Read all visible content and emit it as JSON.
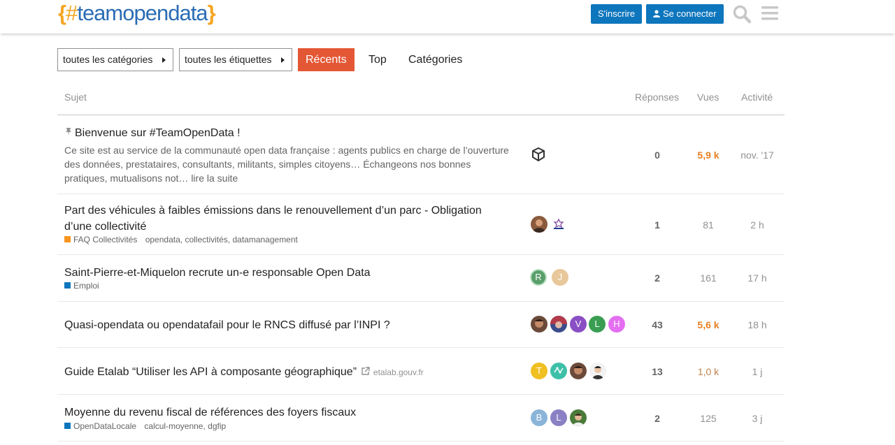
{
  "header": {
    "logo_open": "{",
    "logo_hash": "#",
    "logo_team": "team",
    "logo_rest": "opendata",
    "logo_close": "}",
    "signup_label": "S'inscrire",
    "login_label": "Se connecter"
  },
  "nav": {
    "categories_dropdown": "toutes les catégories",
    "tags_dropdown": "toutes les étiquettes",
    "tabs": [
      "Récents",
      "Top",
      "Catégories"
    ]
  },
  "table": {
    "headers": {
      "topic": "Sujet",
      "replies": "Réponses",
      "views": "Vues",
      "activity": "Activité"
    },
    "rows": [
      {
        "title": "Bienvenue sur #TeamOpenData !",
        "excerpt": "Ce site est au service de la communauté open data française : agents publics en charge de l’ouverture des données, prestataires, consultants, militants, simples citoyens… Échangeons nos bonnes pratiques, mutualisons not… lire la suite",
        "replies": "0",
        "views": "5,9 k",
        "activity": "nov. '17"
      },
      {
        "title_line1": "Part des véhicules à faibles émissions dans le renouvellement d’un parc - Obligation",
        "title_line2": "d’une collectivité",
        "category": "FAQ Collectivités",
        "tags": [
          "opendata",
          "collectivités",
          "datamanagement"
        ],
        "replies": "1",
        "views": "81",
        "activity": "2 h"
      },
      {
        "title": "Saint-Pierre-et-Miquelon recrute un-e responsable Open Data",
        "category": "Emploi",
        "avatars": [
          "R",
          "J"
        ],
        "replies": "2",
        "views": "161",
        "activity": "17 h"
      },
      {
        "title": "Quasi-opendata ou opendatafail pour le RNCS diffusé par l’INPI ?",
        "avatars": [
          "",
          "",
          "V",
          "L",
          "H"
        ],
        "replies": "43",
        "views": "5,6 k",
        "activity": "18 h"
      },
      {
        "title": "Guide Etalab “Utiliser les API à composante géographique”",
        "domain": "etalab.gouv.fr",
        "avatars": [
          "T",
          "",
          "",
          ""
        ],
        "replies": "13",
        "views": "1,0 k",
        "activity": "1 j"
      },
      {
        "title": "Moyenne du revenu fiscal de références des foyers fiscaux",
        "category": "OpenDataLocale",
        "tags": [
          "calcul-moyenne",
          "dgfip"
        ],
        "avatars": [
          "B",
          "L",
          ""
        ],
        "replies": "2",
        "views": "125",
        "activity": "3 j"
      }
    ]
  },
  "colors": {
    "brand_blue": "#0e76bd",
    "accent_orange": "#e45735",
    "hot_views": "#e67e22",
    "cat_faq": "#f7941d",
    "cat_emploi": "#0e76bd",
    "cat_opendatalocale": "#0e76bd"
  },
  "icons": [
    "search-icon",
    "hamburger-icon",
    "user-icon",
    "pin-icon",
    "external-link-icon"
  ]
}
